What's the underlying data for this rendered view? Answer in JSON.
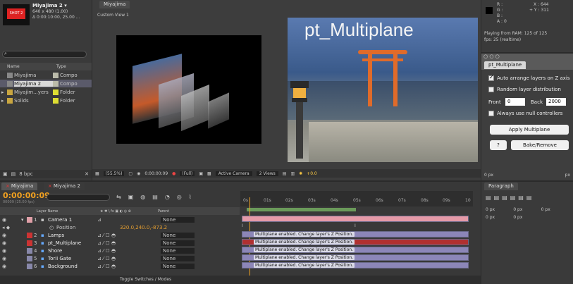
{
  "project": {
    "thumb_text": "SHOT 2",
    "comp_name": "Miyajima 2 ▾",
    "comp_size": "640 x 480 (1.00)",
    "comp_time": "Δ 0:00:10:00, 25.00 ...",
    "col_name": "Name",
    "col_type": "Type",
    "items": [
      {
        "name": "Miyajima",
        "type": "Compo"
      },
      {
        "name": "Miyajima 2",
        "type": "Compo"
      },
      {
        "name": "Miyajim...yers",
        "type": "Folder"
      },
      {
        "name": "Solids",
        "type": "Folder"
      }
    ],
    "bpc": "8 bpc"
  },
  "viewer": {
    "tab": "Miyajima",
    "view_label": "Custom View 1",
    "title_text": "pt_Multiplane",
    "zoom": "(55.5%)",
    "timecode": "0:00:00:09",
    "quality": "(Full)",
    "camera": "Active Camera",
    "views": "2 Views",
    "exposure": "+0.0"
  },
  "info": {
    "r": "R :",
    "g": "G :",
    "b": "B :",
    "a": "A : 0",
    "x": "X : 644",
    "y": "+ Y : 311",
    "playing": "Playing from RAM: 125 of 125",
    "fps": "fps: 25 (realtime)"
  },
  "plugin": {
    "tab": "pt_Multiplane",
    "auto_arrange": "Auto arrange layers on Z axis",
    "random": "Random layer distribution",
    "front_label": "Front",
    "front_val": "0",
    "back_label": "Back",
    "back_val": "2000",
    "null_ctrl": "Always use null controllers",
    "apply_btn": "Apply Multiplane",
    "help_btn": "?",
    "bake_btn": "Bake/Remove"
  },
  "timeline": {
    "tab1": "Miyajima",
    "tab2": "Miyajima 2",
    "timecode": "0:00:00:09",
    "frame_info": "00009 (25.00 fps)",
    "col_layer": "Layer Name",
    "col_parent": "Parent",
    "position_value": "320.0,240.0,-873.2",
    "bar_label": "Multiplane enabled. Change layer's Z Position.",
    "toggle": "Toggle Switches / Modes",
    "ticks": [
      "0s",
      "01s",
      "02s",
      "03s",
      "04s",
      "05s",
      "06s",
      "07s",
      "08s",
      "09s",
      "10"
    ],
    "layers": [
      {
        "num": "1",
        "name": "Camera 1",
        "parent": "None"
      },
      {
        "num": "2",
        "name": "Lamps",
        "parent": "None"
      },
      {
        "num": "3",
        "name": "pt_Multiplane",
        "parent": "None"
      },
      {
        "num": "4",
        "name": "Shore",
        "parent": "None"
      },
      {
        "num": "5",
        "name": "Torii Gate",
        "parent": "None"
      },
      {
        "num": "6",
        "name": "Background",
        "parent": "None"
      }
    ],
    "position_label": "Position"
  },
  "paragraph": {
    "tab": "Paragraph",
    "px": "0 px",
    "px2": "px"
  },
  "colors": {
    "accent": "#f0a020",
    "bar": "#8c86b8",
    "bar_selected": "#b03030",
    "cam_bar": "#e59aa8"
  }
}
